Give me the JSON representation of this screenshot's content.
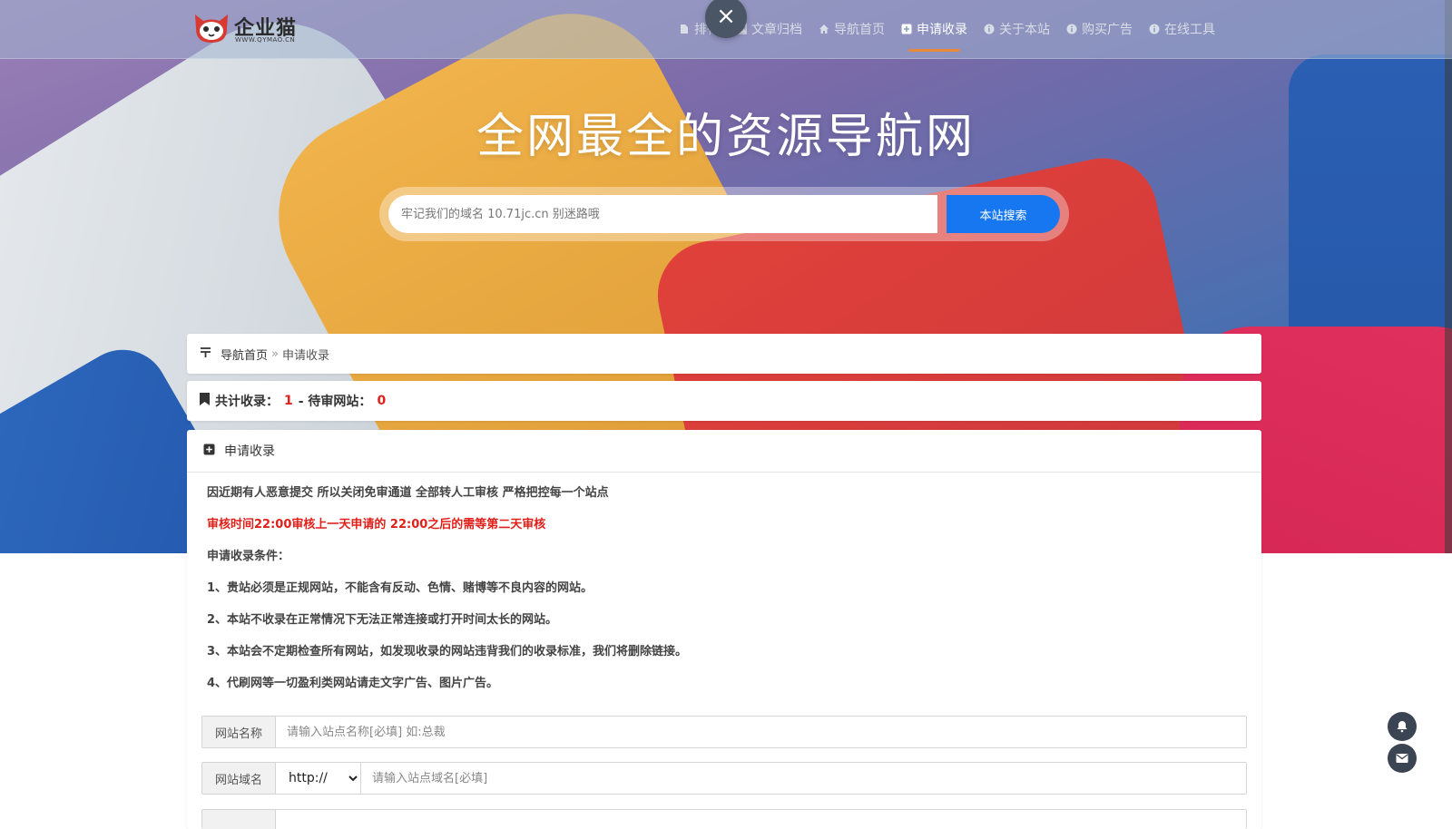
{
  "logo": {
    "name": "企业猫",
    "sub": "WWW.QYMAO.CN"
  },
  "nav": {
    "items": [
      {
        "label": "排行"
      },
      {
        "label": "文章归档"
      },
      {
        "label": "导航首页"
      },
      {
        "label": "申请收录"
      },
      {
        "label": "关于本站"
      },
      {
        "label": "购买广告"
      },
      {
        "label": "在线工具"
      }
    ],
    "close_symbol": "×"
  },
  "hero": {
    "title": "全网最全的资源导航网",
    "search_placeholder": "牢记我们的域名 10.71jc.cn 别迷路哦",
    "search_button": "本站搜索"
  },
  "breadcrumb": {
    "home": "导航首页",
    "separator": "»",
    "current": "申请收录"
  },
  "stats": {
    "prefix": "共计收录：",
    "total": "1",
    "mid": "- 待审网站：",
    "pending": "0"
  },
  "apply": {
    "heading": "申请收录",
    "notice": "因近期有人恶意提交 所以关闭免审通道 全部转人工审核 严格把控每一个站点",
    "review_time": "审核时间22:00审核上一天申请的 22:00之后的需等第二天审核",
    "conditions_title": "申请收录条件：",
    "conditions": [
      "1、贵站必须是正规网站，不能含有反动、色情、赌博等不良内容的网站。",
      "2、本站不收录在正常情况下无法正常连接或打开时间太长的网站。",
      "3、本站会不定期检查所有网站，如发现收录的网站违背我们的收录标准，我们将删除链接。",
      "4、代刷网等一切盈利类网站请走文字广告、图片广告。"
    ],
    "form": {
      "name_label": "网站名称",
      "name_placeholder": "请输入站点名称[必填] 如:总裁",
      "domain_label": "网站域名",
      "protocol_selected": "http://",
      "domain_placeholder": "请输入站点域名[必填]"
    }
  },
  "colors": {
    "accent": "#1677f0",
    "highlight": "#e0201b",
    "nav_active_bar": "#e8883a"
  }
}
